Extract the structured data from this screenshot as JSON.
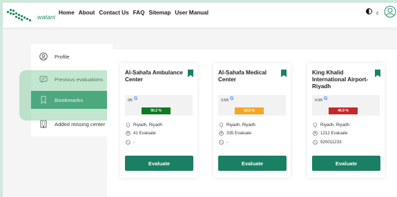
{
  "header": {
    "logo_text": "watani",
    "nav": [
      "Home",
      "About",
      "Contact Us",
      "FAQ",
      "Sitemap",
      "User Manual"
    ],
    "lang_label": "ع"
  },
  "sidebar": {
    "items": [
      {
        "label": "Profile",
        "icon": "profile-icon",
        "active": false
      },
      {
        "label": "Previous evaluations",
        "icon": "evaluations-icon",
        "active": false
      },
      {
        "label": "Bookmarks",
        "icon": "bookmark-icon",
        "active": true
      },
      {
        "label": "Added missing center",
        "icon": "building-icon",
        "active": false
      }
    ]
  },
  "cards": [
    {
      "title": "Al-Sahafa Ambulance Center",
      "rating": "0/5",
      "percent_label": "90.2 %",
      "percent_color": "#0f7a22",
      "location": "Riyadh, Riyadh",
      "evaluations": "41 Evaluate",
      "phone": "-",
      "button": "Evaluate"
    },
    {
      "title": "Al-Sahafa Medical Center",
      "rating": "3.6/5",
      "percent_label": "59.5 %",
      "percent_color": "#f5a623",
      "location": "Riyadh, Riyadh",
      "evaluations": "335 Evaluate",
      "phone": "-",
      "button": "Evaluate"
    },
    {
      "title": "King Khalid International Airport-Riyadh",
      "rating": "4.0/5",
      "percent_label": "46.9 %",
      "percent_color": "#c62828",
      "location": "Riyadh, Riyadh",
      "evaluations": "1212 Evaluate",
      "phone": "920011233",
      "button": "Evaluate"
    }
  ],
  "colors": {
    "brand": "#2a8f6a",
    "button": "#1a7f63",
    "bookmark": "#1a7f63"
  }
}
